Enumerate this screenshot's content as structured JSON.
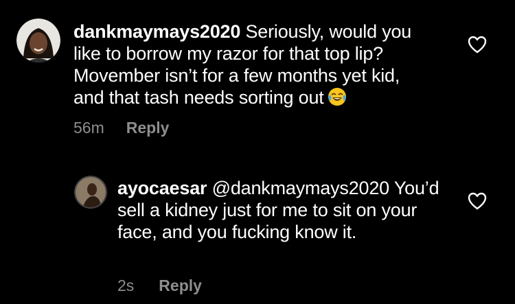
{
  "comments": [
    {
      "username": "dankmaymays2020",
      "text": "Seriously, would you like to borrow my razor for that top lip? Movember isn’t for a few months yet kid, and that tash needs sorting out",
      "emoji": "face-with-tears-of-joy",
      "time": "56m",
      "reply_label": "Reply",
      "like_icon": "heart-outline-icon"
    },
    {
      "username": "ayocaesar",
      "mention": "@dankmaymays2020",
      "text": "You’d sell a kidney just for me to sit on your face, and you fucking know it.",
      "time": "2s",
      "reply_label": "Reply",
      "like_icon": "heart-outline-icon"
    }
  ],
  "colors": {
    "background": "#000000",
    "text": "#ffffff",
    "secondary_text": "#8e8e8e"
  }
}
